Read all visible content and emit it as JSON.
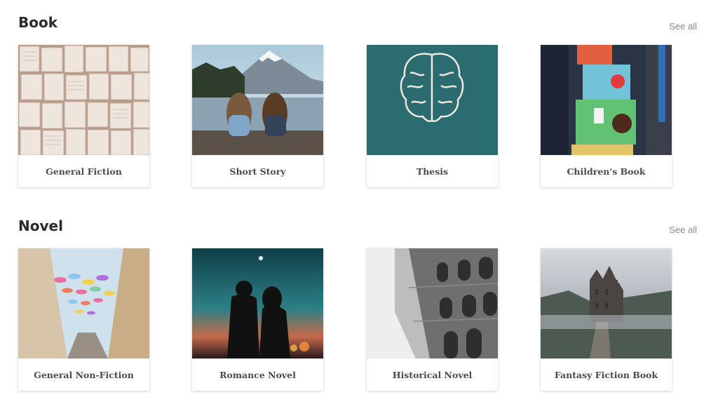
{
  "sections": [
    {
      "title": "Book",
      "see_all": "See all",
      "cards": [
        {
          "label": "General Fiction"
        },
        {
          "label": "Short Story"
        },
        {
          "label": "Thesis"
        },
        {
          "label": "Children's Book"
        }
      ]
    },
    {
      "title": "Novel",
      "see_all": "See all",
      "cards": [
        {
          "label": "General Non-Fiction"
        },
        {
          "label": "Romance Novel"
        },
        {
          "label": "Historical Novel"
        },
        {
          "label": "Fantasy Fiction Book"
        }
      ]
    }
  ]
}
